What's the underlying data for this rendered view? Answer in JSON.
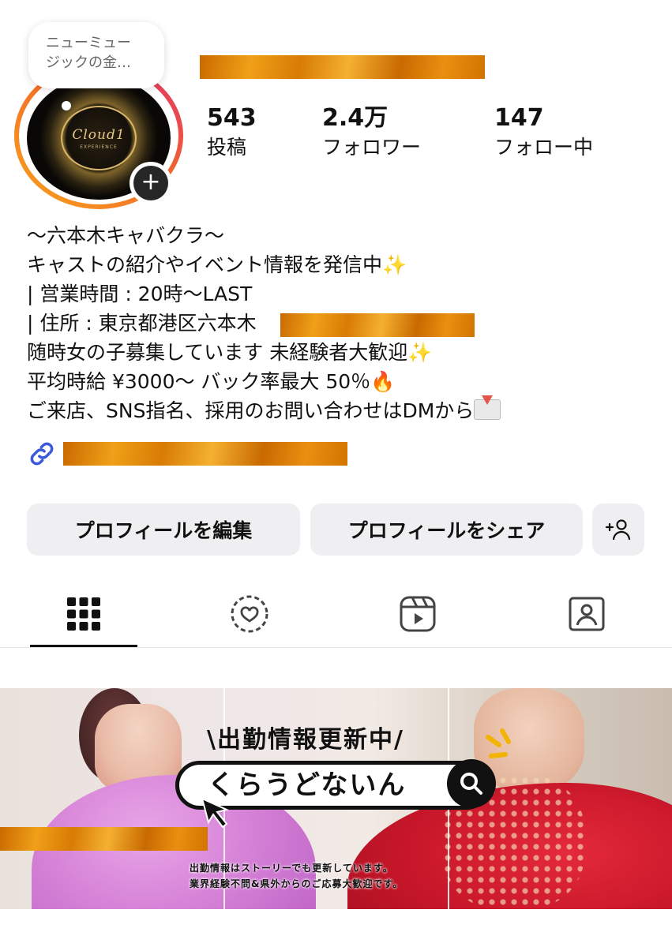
{
  "profile": {
    "note": "ニューミュージックの金…",
    "note_line1": "ニューミュー",
    "note_line2": "ジックの金…",
    "avatar_logo_text": "Cloud1",
    "avatar_logo_sub": "EXPERIENCE",
    "add_story_glyph": "+"
  },
  "stats": {
    "posts": {
      "value": "543",
      "label": "投稿"
    },
    "followers": {
      "value": "2.4万",
      "label": "フォロワー"
    },
    "following": {
      "value": "147",
      "label": "フォロー中"
    }
  },
  "bio": {
    "lines": [
      "〜六本木キャバクラ〜",
      "キャストの紹介やイベント情報を発信中",
      "| 営業時間 : 20時〜LAST",
      "| 住所 : 東京都港区六本木",
      "随時女の子募集しています 未経験者大歓迎",
      "平均時給 ¥3000〜 バック率最大 50％",
      "ご来店、SNS指名、採用のお問い合わせはDMから"
    ],
    "emoji_sparkle": "✨",
    "emoji_fire": "🔥"
  },
  "actions": {
    "edit_profile": "プロフィールを編集",
    "share_profile": "プロフィールをシェア"
  },
  "tabs": [
    "grid-icon",
    "reposts-icon",
    "reels-icon",
    "tagged-icon"
  ],
  "banner": {
    "title": "\\出勤情報更新中/",
    "search_text": "くらうどないん",
    "small_line1": "出勤情報はストーリーでも更新しています。",
    "small_line2": "業界経験不問&県外からのご応募大歓迎です。"
  },
  "colors": {
    "redaction": "#e08a10",
    "ring_start": "#f9a11c",
    "ring_end": "#e1306c",
    "button_bg": "#efeff1",
    "link_blue": "#3a5bd9"
  }
}
